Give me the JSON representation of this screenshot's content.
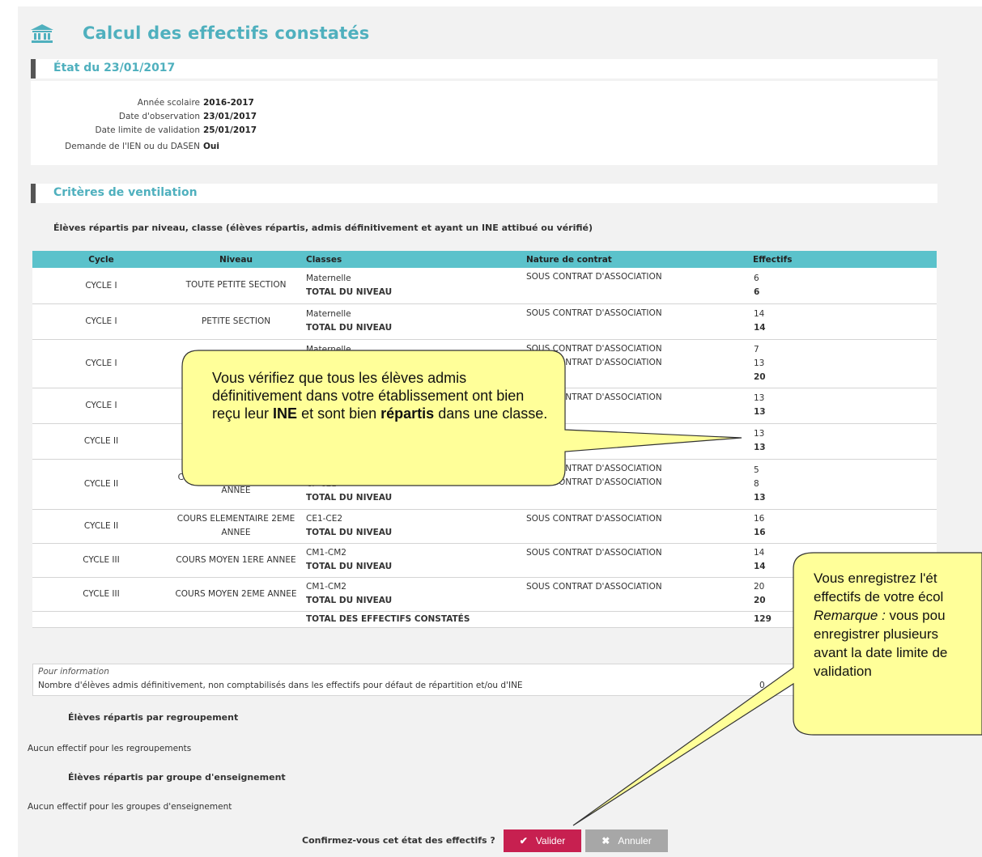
{
  "header": {
    "title": "Calcul des effectifs constatés",
    "icon": "bank-icon"
  },
  "etat": {
    "heading": "État du 23/01/2017",
    "rows": [
      {
        "label": "Année scolaire",
        "value": "2016-2017"
      },
      {
        "label": "Date d'observation",
        "value": "23/01/2017"
      },
      {
        "label": "Date limite de validation",
        "value": "25/01/2017"
      },
      {
        "label": "Demande de l'IEN ou du DASEN",
        "value": "Oui"
      }
    ]
  },
  "criteres": {
    "heading": "Critères de ventilation",
    "subtitle": "Élèves répartis par niveau, classe (élèves répartis, admis définitivement et ayant un INE attibué ou vérifié)"
  },
  "table": {
    "headers": {
      "cycle": "Cycle",
      "niveau": "Niveau",
      "classes": "Classes",
      "nature": "Nature de contrat",
      "effectifs": "Effectifs"
    },
    "rows": [
      {
        "cycle": "CYCLE I",
        "niveau": "TOUTE PETITE SECTION",
        "classes": [
          "Maternelle",
          "TOTAL DU NIVEAU"
        ],
        "nature": [
          "SOUS CONTRAT D'ASSOCIATION"
        ],
        "effectifs": [
          "6",
          "6"
        ]
      },
      {
        "cycle": "CYCLE I",
        "niveau": "PETITE SECTION",
        "classes": [
          "Maternelle",
          "TOTAL DU NIVEAU"
        ],
        "nature": [
          "SOUS CONTRAT D'ASSOCIATION"
        ],
        "effectifs": [
          "14",
          "14"
        ]
      },
      {
        "cycle": "CYCLE I",
        "niveau": "",
        "classes": [
          "Maternelle",
          "",
          ""
        ],
        "nature": [
          "SOUS CONTRAT D'ASSOCIATION",
          "SOUS CONTRAT D'ASSOCIATION"
        ],
        "effectifs": [
          "7",
          "13",
          "20"
        ]
      },
      {
        "cycle": "CYCLE I",
        "niveau": "",
        "classes": [
          "",
          ""
        ],
        "nature": [
          "SOUS CONTRAT D'ASSOCIATION"
        ],
        "effectifs": [
          "13",
          "13"
        ]
      },
      {
        "cycle": "CYCLE II",
        "niveau": "",
        "classes": [
          "",
          ""
        ],
        "nature": [
          ""
        ],
        "effectifs": [
          "13",
          "13"
        ]
      },
      {
        "cycle": "CYCLE II",
        "niveau": "COURS ELEMENTAIRE 1ERE ANNEE",
        "classes": [
          "",
          "CP-CE1",
          "TOTAL DU NIVEAU"
        ],
        "nature": [
          "SOUS CONTRAT D'ASSOCIATION",
          "SOUS CONTRAT D'ASSOCIATION"
        ],
        "effectifs": [
          "5",
          "8",
          "13"
        ]
      },
      {
        "cycle": "CYCLE II",
        "niveau": "COURS ELEMENTAIRE 2EME ANNEE",
        "classes": [
          "CE1-CE2",
          "TOTAL DU NIVEAU"
        ],
        "nature": [
          "SOUS CONTRAT D'ASSOCIATION"
        ],
        "effectifs": [
          "16",
          "16"
        ]
      },
      {
        "cycle": "CYCLE III",
        "niveau": "COURS MOYEN 1ERE ANNEE",
        "classes": [
          "CM1-CM2",
          "TOTAL DU NIVEAU"
        ],
        "nature": [
          "SOUS CONTRAT D'ASSOCIATION"
        ],
        "effectifs": [
          "14",
          "14"
        ]
      },
      {
        "cycle": "CYCLE III",
        "niveau": "COURS MOYEN 2EME ANNEE",
        "classes": [
          "CM1-CM2",
          "TOTAL DU NIVEAU"
        ],
        "nature": [
          "SOUS CONTRAT D'ASSOCIATION"
        ],
        "effectifs": [
          "20",
          "20"
        ]
      }
    ],
    "total_label": "TOTAL DES EFFECTIFS CONSTATÉS",
    "total_value": "129"
  },
  "information": {
    "title": "Pour information",
    "text": "Nombre d'élèves admis définitivement, non comptabilisés dans les effectifs pour défaut de répartition et/ou d'INE",
    "value": "0"
  },
  "regroupement": {
    "heading": "Élèves répartis par regroupement",
    "text": "Aucun effectif pour les regroupements"
  },
  "groupe": {
    "heading": "Élèves répartis par groupe d'enseignement",
    "text": "Aucun effectif pour les groupes d'enseignement"
  },
  "footer": {
    "question": "Confirmez-vous cet état des effectifs ?",
    "valider": "Valider",
    "annuler": "Annuler"
  },
  "callout1": {
    "part1": "Vous vérifiez que tous les élèves admis définitivement dans votre établissement ont bien reçu leur ",
    "bold1": "INE",
    "part2": " et sont bien ",
    "bold2": "répartis",
    "part3": " dans une classe."
  },
  "callout2": {
    "line1": "Vous  enregistrez l'ét",
    "line2": "effectifs de votre écol",
    "remarque": "Remarque :",
    "line3": " vous pou",
    "line4": "enregistrer plusieurs ",
    "line5": "avant la date limite de",
    "line6": "validation"
  },
  "colors": {
    "accent": "#4fb0be",
    "table_header": "#5bc2cb",
    "valider": "#c72050",
    "annuler": "#a7a7a7",
    "callout_fill": "#ffff99"
  }
}
